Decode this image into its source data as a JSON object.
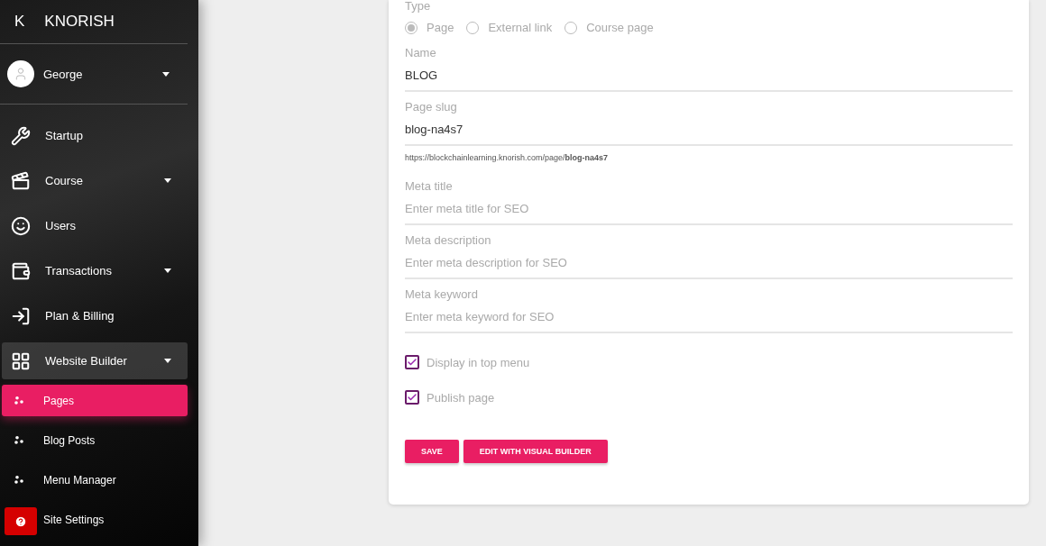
{
  "brand": {
    "letter": "K",
    "name": "KNORISH"
  },
  "user": {
    "name": "George"
  },
  "sidebar": {
    "items": [
      {
        "label": "Startup",
        "caret": false,
        "expanded": false
      },
      {
        "label": "Course",
        "caret": true,
        "expanded": false
      },
      {
        "label": "Users",
        "caret": false,
        "expanded": false
      },
      {
        "label": "Transactions",
        "caret": true,
        "expanded": false
      },
      {
        "label": "Plan & Billing",
        "caret": false,
        "expanded": false
      },
      {
        "label": "Website Builder",
        "caret": true,
        "expanded": true,
        "children": [
          {
            "label": "Pages",
            "selected": true
          },
          {
            "label": "Blog Posts",
            "selected": false
          },
          {
            "label": "Menu Manager",
            "selected": false
          },
          {
            "label": "Site Settings",
            "selected": false
          }
        ]
      }
    ]
  },
  "form": {
    "type_label": "Type",
    "type_options": [
      {
        "label": "Page",
        "selected": true
      },
      {
        "label": "External link",
        "selected": false
      },
      {
        "label": "Course page",
        "selected": false
      }
    ],
    "fields": [
      {
        "label": "Name",
        "value": "BLOG"
      },
      {
        "label": "Page slug",
        "value": "blog-na4s7",
        "hint": "https://blockchainlearning.knorish.com/page/**blog-na4s7**"
      },
      {
        "label": "Meta title",
        "placeholder": "Enter meta title for SEO"
      },
      {
        "label": "Meta description",
        "placeholder": "Enter meta description for SEO"
      },
      {
        "label": "Meta keyword",
        "placeholder": "Enter meta keyword for SEO"
      }
    ],
    "checkboxes": [
      {
        "label": "Display in top menu",
        "checked": true
      },
      {
        "label": "Publish page",
        "checked": true
      }
    ],
    "buttons": [
      "SAVE",
      "EDIT WITH VISUAL BUILDER"
    ]
  }
}
